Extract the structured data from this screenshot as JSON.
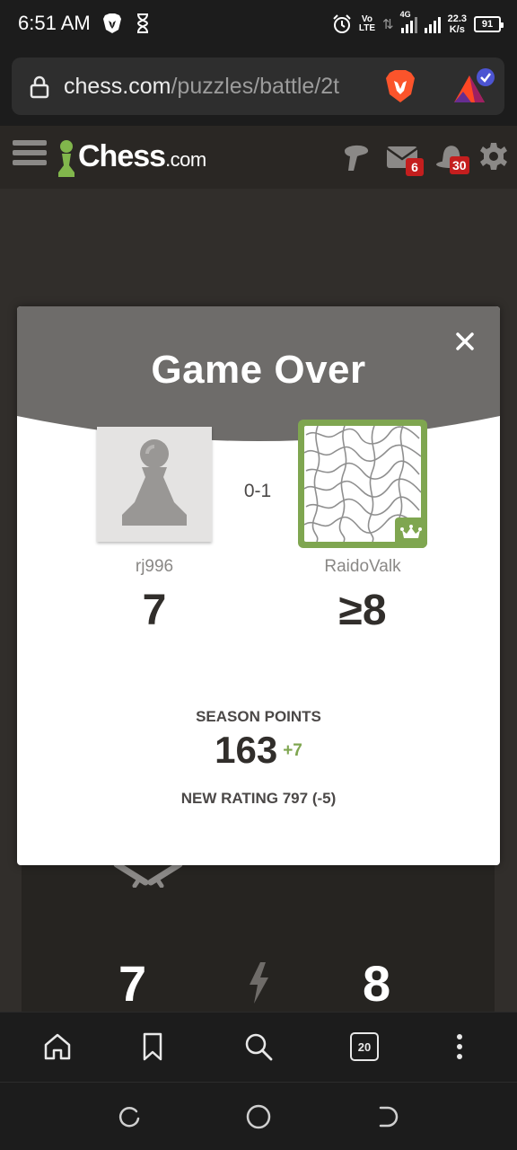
{
  "status_bar": {
    "time": "6:51 AM",
    "network_volte": "Vo\nLTE",
    "network_type": "4G",
    "speed_value": "22.3",
    "speed_unit": "K/s",
    "battery": "91"
  },
  "browser": {
    "url_host": "chess.com",
    "url_path": "/puzzles/battle/2t",
    "open_tabs": "20"
  },
  "chess_header": {
    "logo_text": "Chess",
    "logo_suffix": ".com",
    "messages_badge": "6",
    "notifications_badge": "30"
  },
  "modal": {
    "title": "Game Over",
    "score": "0-1",
    "player_left": {
      "name": "rj996",
      "points": "7"
    },
    "player_right": {
      "name": "RaidoValk",
      "points": "≥8"
    },
    "season_label": "SEASON POINTS",
    "season_value": "163",
    "season_delta": "+7",
    "rating_text": "NEW RATING 797 (-5)"
  },
  "background": {
    "score_left": "7",
    "score_right": "8"
  },
  "colors": {
    "chess_green": "#7fa650",
    "modal_header": "#6e6c6a",
    "page_bg": "#312e2b",
    "badge_red": "#c41e1e"
  }
}
